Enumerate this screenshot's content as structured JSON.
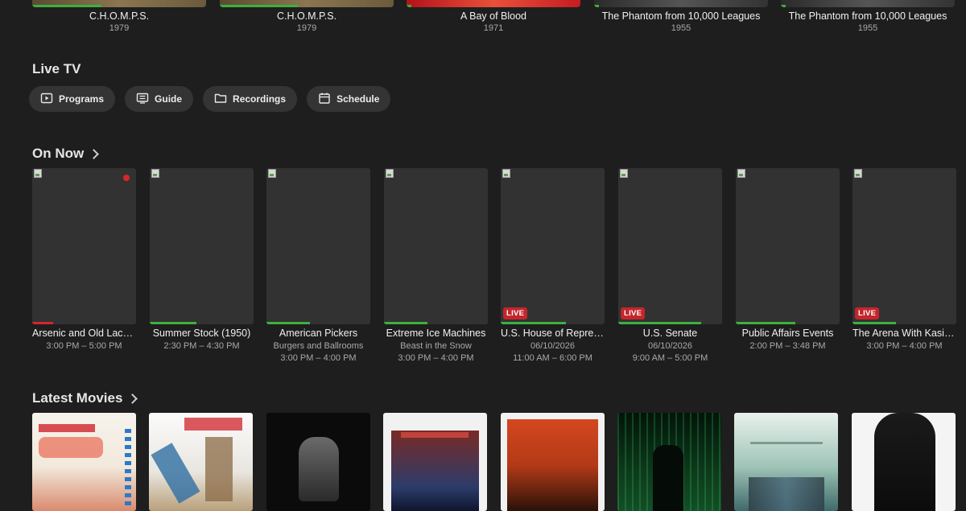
{
  "top_row": [
    {
      "title": "C.H.O.M.P.S.",
      "year": "1979"
    },
    {
      "title": "C.H.O.M.P.S.",
      "year": "1979"
    },
    {
      "title": "A Bay of Blood",
      "year": "1971"
    },
    {
      "title": "The Phantom from 10,000 Leagues",
      "year": "1955"
    },
    {
      "title": "The Phantom from 10,000 Leagues",
      "year": "1955"
    }
  ],
  "live_tv": {
    "title": "Live TV",
    "buttons": [
      {
        "label": "Programs",
        "icon": "play-screen-icon"
      },
      {
        "label": "Guide",
        "icon": "guide-icon"
      },
      {
        "label": "Recordings",
        "icon": "folder-icon"
      },
      {
        "label": "Schedule",
        "icon": "calendar-icon"
      }
    ]
  },
  "on_now": {
    "title": "On Now",
    "items": [
      {
        "title": "Arsenic and Old Lace ...",
        "line1": "3:00 PM – 5:00 PM",
        "line2": "",
        "live": false,
        "recording": true,
        "progress": 0.2,
        "progress_color": "#d6262c"
      },
      {
        "title": "Summer Stock (1950)",
        "line1": "2:30 PM – 4:30 PM",
        "line2": "",
        "live": false,
        "recording": false,
        "progress": 0.45,
        "progress_color": "#3db03d"
      },
      {
        "title": "American Pickers",
        "line1": "Burgers and Ballrooms",
        "line2": "3:00 PM – 4:00 PM",
        "live": false,
        "recording": false,
        "progress": 0.42,
        "progress_color": "#3db03d"
      },
      {
        "title": "Extreme Ice Machines",
        "line1": "Beast in the Snow",
        "line2": "3:00 PM – 4:00 PM",
        "live": false,
        "recording": false,
        "progress": 0.42,
        "progress_color": "#3db03d"
      },
      {
        "title": "U.S. House of Represe...",
        "line1": "06/10/2026",
        "line2": "11:00 AM – 6:00 PM",
        "live": true,
        "recording": false,
        "progress": 0.63,
        "progress_color": "#3db03d"
      },
      {
        "title": "U.S. Senate",
        "line1": "06/10/2026",
        "line2": "9:00 AM – 5:00 PM",
        "live": true,
        "recording": false,
        "progress": 0.8,
        "progress_color": "#3db03d"
      },
      {
        "title": "Public Affairs Events",
        "line1": "2:00 PM – 3:48 PM",
        "line2": "",
        "live": false,
        "recording": false,
        "progress": 0.57,
        "progress_color": "#3db03d"
      },
      {
        "title": "The Arena With Kasie ...",
        "line1": "3:00 PM – 4:00 PM",
        "line2": "",
        "live": true,
        "recording": false,
        "progress": 0.42,
        "progress_color": "#3db03d"
      }
    ],
    "live_label": "LIVE"
  },
  "latest_movies": {
    "title": "Latest Movies"
  },
  "colors": {
    "background": "#1e1e1e",
    "pill": "#343434",
    "progress": "#3db03d",
    "live": "#c4262b"
  }
}
